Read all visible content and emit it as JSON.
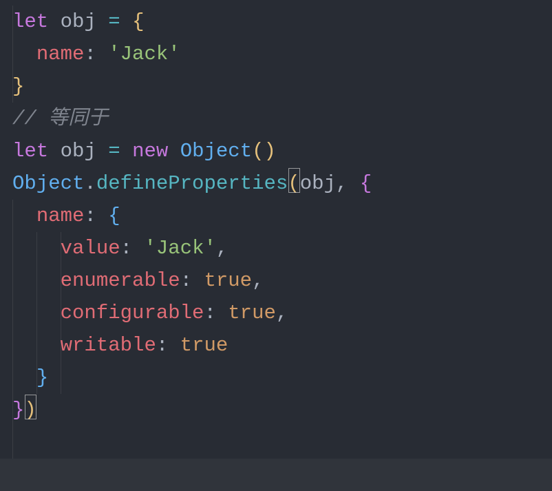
{
  "lines": [
    [
      {
        "cls": "kw",
        "t": "let"
      },
      {
        "cls": "pun",
        "t": " "
      },
      {
        "cls": "var",
        "t": "obj"
      },
      {
        "cls": "pun",
        "t": " "
      },
      {
        "cls": "op",
        "t": "="
      },
      {
        "cls": "pun",
        "t": " "
      },
      {
        "cls": "br-y",
        "t": "{"
      }
    ],
    [
      {
        "cls": "pun",
        "t": "  "
      },
      {
        "cls": "prop",
        "t": "name"
      },
      {
        "cls": "pun",
        "t": ": "
      },
      {
        "cls": "str",
        "t": "'Jack'"
      }
    ],
    [
      {
        "cls": "br-y",
        "t": "}"
      }
    ],
    [
      {
        "cls": "cmt",
        "t": "// 等同于"
      }
    ],
    [
      {
        "cls": "kw",
        "t": "let"
      },
      {
        "cls": "pun",
        "t": " "
      },
      {
        "cls": "var",
        "t": "obj"
      },
      {
        "cls": "pun",
        "t": " "
      },
      {
        "cls": "op",
        "t": "="
      },
      {
        "cls": "pun",
        "t": " "
      },
      {
        "cls": "kw",
        "t": "new"
      },
      {
        "cls": "pun",
        "t": " "
      },
      {
        "cls": "cls",
        "t": "Object"
      },
      {
        "cls": "br-y",
        "t": "("
      },
      {
        "cls": "br-y",
        "t": ")"
      }
    ],
    [
      {
        "cls": "cls",
        "t": "Object"
      },
      {
        "cls": "pun",
        "t": "."
      },
      {
        "cls": "fn",
        "t": "defineProperties"
      },
      {
        "cls": "br-y",
        "t": "("
      },
      {
        "cls": "cursor",
        "t": ""
      },
      {
        "cls": "var",
        "t": "obj"
      },
      {
        "cls": "pun",
        "t": ", "
      },
      {
        "cls": "br-m",
        "t": "{"
      }
    ],
    [
      {
        "cls": "pun",
        "t": "  "
      },
      {
        "cls": "prop",
        "t": "name"
      },
      {
        "cls": "pun",
        "t": ": "
      },
      {
        "cls": "br-b",
        "t": "{"
      }
    ],
    [
      {
        "cls": "pun",
        "t": "    "
      },
      {
        "cls": "prop",
        "t": "value"
      },
      {
        "cls": "pun",
        "t": ": "
      },
      {
        "cls": "str",
        "t": "'Jack'"
      },
      {
        "cls": "pun",
        "t": ","
      }
    ],
    [
      {
        "cls": "pun",
        "t": "    "
      },
      {
        "cls": "prop",
        "t": "enumerable"
      },
      {
        "cls": "pun",
        "t": ": "
      },
      {
        "cls": "bool",
        "t": "true"
      },
      {
        "cls": "pun",
        "t": ","
      }
    ],
    [
      {
        "cls": "pun",
        "t": "    "
      },
      {
        "cls": "prop",
        "t": "configurable"
      },
      {
        "cls": "pun",
        "t": ": "
      },
      {
        "cls": "bool",
        "t": "true"
      },
      {
        "cls": "pun",
        "t": ","
      }
    ],
    [
      {
        "cls": "pun",
        "t": "    "
      },
      {
        "cls": "prop",
        "t": "writable"
      },
      {
        "cls": "pun",
        "t": ": "
      },
      {
        "cls": "bool",
        "t": "true"
      }
    ],
    [
      {
        "cls": "pun",
        "t": "  "
      },
      {
        "cls": "br-b",
        "t": "}"
      }
    ],
    [
      {
        "cls": "br-m",
        "t": "}"
      },
      {
        "cls": "br-y",
        "t": ")"
      },
      {
        "cls": "cursor",
        "t": ""
      }
    ]
  ]
}
